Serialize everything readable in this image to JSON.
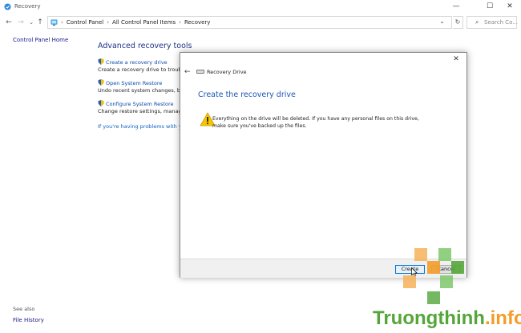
{
  "window": {
    "title": "Recovery",
    "controls": {
      "minimize": "—",
      "maximize": "☐",
      "close": "✕"
    }
  },
  "nav": {
    "back": "←",
    "forward": "→",
    "recent": "⌄",
    "up": "↑"
  },
  "address": {
    "crumbs": [
      "Control Panel",
      "All Control Panel Items",
      "Recovery"
    ],
    "separator": "›",
    "dropdown": "⌄",
    "refresh": "↻"
  },
  "search": {
    "placeholder": "Search Co..."
  },
  "sidebar": {
    "home_link": "Control Panel Home",
    "see_also": "See also",
    "file_history": "File History"
  },
  "main": {
    "heading": "Advanced recovery tools",
    "tools": [
      {
        "link": "Create a recovery drive",
        "desc": "Create a recovery drive to troubleshoot problems when your PC can't start."
      },
      {
        "link": "Open System Restore",
        "desc": "Undo recent system changes, but leave files such as documents, pictures, and music unchanged."
      },
      {
        "link": "Configure System Restore",
        "desc": "Change restore settings, manage disk space, and create or delete restore points."
      }
    ],
    "problems_link": "If you're having problems with your PC, go to Settings and try resetting it"
  },
  "dialog": {
    "close": "✕",
    "back": "←",
    "window_title": "Recovery Drive",
    "heading": "Create the recovery drive",
    "message": "Everything on the drive will be deleted. If you have any personal files on this drive, make sure you've backed up the files.",
    "buttons": {
      "create": "Create",
      "cancel": "Cancel"
    }
  },
  "watermark": {
    "name": "Truongthinh",
    "domain": ".info"
  },
  "colors": {
    "link": "#0b4aa8",
    "heading": "#1e3287",
    "dialog_heading": "#1a56b8",
    "accent_border": "#0078d7"
  }
}
